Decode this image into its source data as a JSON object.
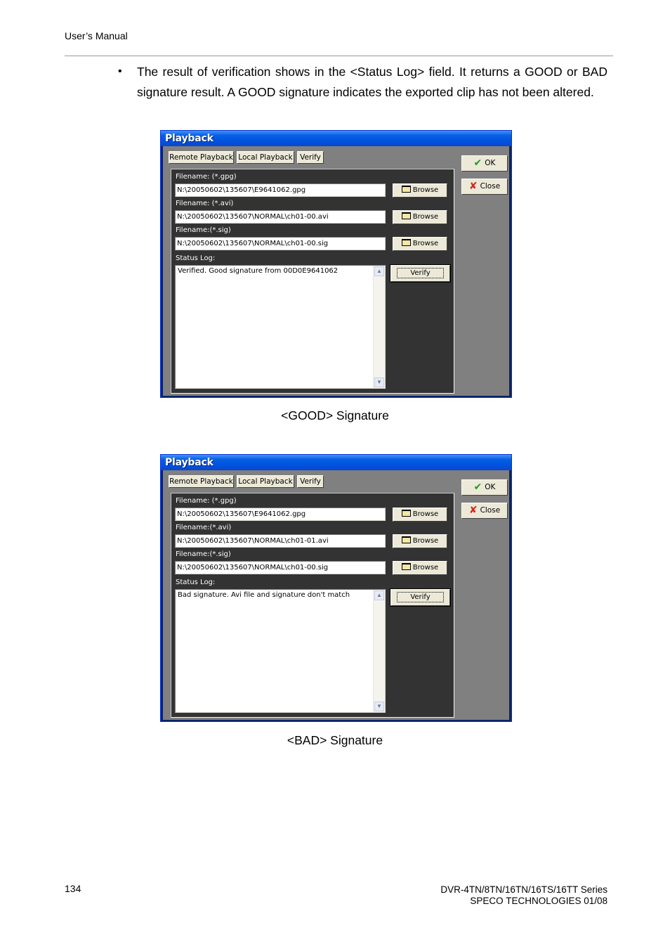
{
  "header": {
    "title": "User’s Manual"
  },
  "bullet": {
    "text": "The result of verification shows in the <Status Log> field. It returns a GOOD or BAD signature result. A GOOD signature indicates the exported clip has not been altered."
  },
  "dialog_common": {
    "title": "Playback",
    "tabs": [
      "Remote Playback",
      "Local Playback",
      "Verify"
    ],
    "labels": {
      "gpg": "Filename: (*.gpg)",
      "avi": "Filename: (*.avi)",
      "sig": "Filename:(*.sig)",
      "status": "Status Log:"
    },
    "browse_label": "Browse",
    "verify_label": "Verify",
    "ok_label": "OK",
    "close_label": "Close"
  },
  "dialog_good": {
    "label_avi": "Filename: (*.avi)",
    "gpg_value": "N:\\20050602\\135607\\E9641062.gpg",
    "avi_value": "N:\\20050602\\135607\\NORMAL\\ch01-00.avi",
    "sig_value": "N:\\20050602\\135607\\NORMAL\\ch01-00.sig",
    "status_log": "Verified. Good signature from 00D0E9641062"
  },
  "dialog_bad": {
    "label_avi": "Filename:(*.avi)",
    "gpg_value": "N:\\20050602\\135607\\E9641062.gpg",
    "avi_value": "N:\\20050602\\135607\\NORMAL\\ch01-01.avi",
    "sig_value": "N:\\20050602\\135607\\NORMAL\\ch01-00.sig",
    "status_log": "Bad signature. Avi file and signature don't match"
  },
  "captions": {
    "good": "<GOOD> Signature",
    "bad": "<BAD> Signature"
  },
  "footer": {
    "page_number": "134",
    "series": "DVR-4TN/8TN/16TN/16TS/16TT Series",
    "company": "SPECO TECHNOLOGIES 01/08"
  },
  "colors": {
    "title_bar": "#0054e3",
    "panel": "#333333",
    "client": "#808080",
    "button_face": "#ece9d8"
  }
}
